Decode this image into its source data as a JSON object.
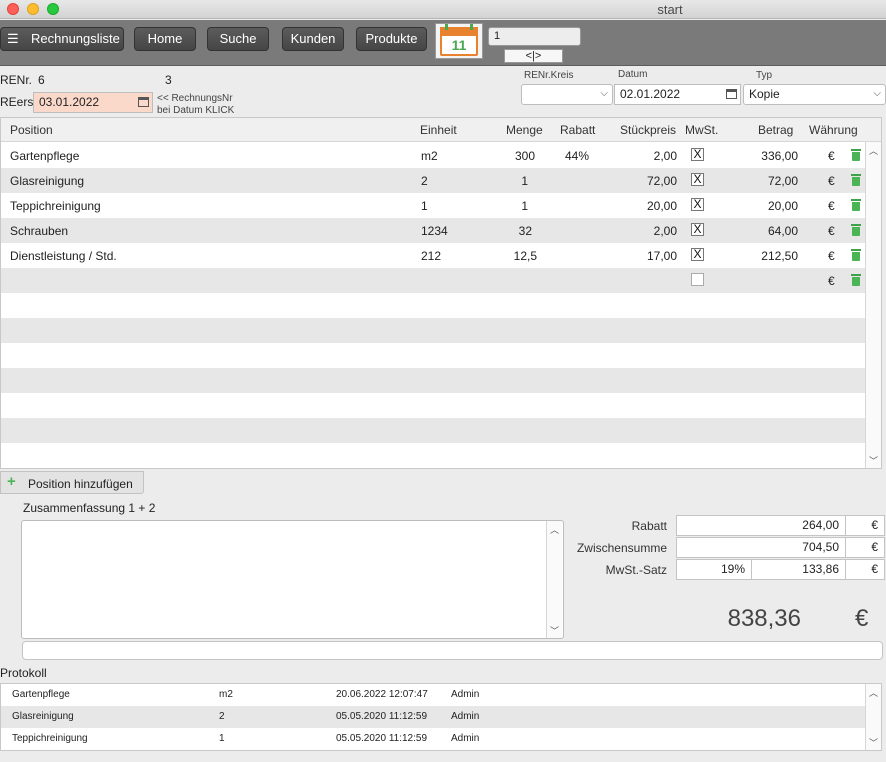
{
  "window": {
    "title": "start"
  },
  "toolbar": {
    "list_label": "Rechnungsliste",
    "home_label": "Home",
    "search_label": "Suche",
    "customers_label": "Kunden",
    "products_label": "Produkte",
    "calendar_day": "11",
    "record_number": "1",
    "nav_label": "<|>"
  },
  "header": {
    "renr_label": "RENr.",
    "renr_value": "6",
    "renr_second": "3",
    "reers_label": "REers",
    "reers_date": "03.01.2022",
    "hint_line1": "<< RechnungsNr",
    "hint_line2": "bei Datum KLICK",
    "kreis_label": "RENr.Kreis",
    "kreis_value": "",
    "datum_label": "Datum",
    "datum_value": "02.01.2022",
    "typ_label": "Typ",
    "typ_value": "Kopie"
  },
  "table": {
    "columns": [
      "Position",
      "Einheit",
      "Menge",
      "Rabatt",
      "Stückpreis",
      "MwSt.",
      "Betrag",
      "Währung"
    ],
    "rows": [
      {
        "position": "Gartenpflege",
        "einheit": "m2",
        "menge": "300",
        "rabatt": "44%",
        "stueckpreis": "2,00",
        "mwst": "X",
        "betrag": "336,00",
        "waehrung": "€"
      },
      {
        "position": "Glasreinigung",
        "einheit": "2",
        "menge": "1",
        "rabatt": "",
        "stueckpreis": "72,00",
        "mwst": "X",
        "betrag": "72,00",
        "waehrung": "€"
      },
      {
        "position": "Teppichreinigung",
        "einheit": "1",
        "menge": "1",
        "rabatt": "",
        "stueckpreis": "20,00",
        "mwst": "X",
        "betrag": "20,00",
        "waehrung": "€"
      },
      {
        "position": "Schrauben",
        "einheit": "1234",
        "menge": "32",
        "rabatt": "",
        "stueckpreis": "2,00",
        "mwst": "X",
        "betrag": "64,00",
        "waehrung": "€"
      },
      {
        "position": "Dienstleistung / Std.",
        "einheit": "212",
        "menge": "12,5",
        "rabatt": "",
        "stueckpreis": "17,00",
        "mwst": "X",
        "betrag": "212,50",
        "waehrung": "€"
      },
      {
        "position": "",
        "einheit": "",
        "menge": "",
        "rabatt": "",
        "stueckpreis": "",
        "mwst": "",
        "betrag": "",
        "waehrung": "€"
      }
    ]
  },
  "actions": {
    "add_position_label": "Position hinzufügen"
  },
  "summary": {
    "heading": "Zusammenfassung 1 + 2",
    "text": "",
    "rabatt_label": "Rabatt",
    "rabatt_value": "264,00",
    "rabatt_currency": "€",
    "zwischensumme_label": "Zwischensumme",
    "zwischensumme_value": "704,50",
    "zwischensumme_currency": "€",
    "mwst_label": "MwSt.-Satz",
    "mwst_rate": "19%",
    "mwst_value": "133,86",
    "mwst_currency": "€",
    "total_value": "838,36",
    "total_currency": "€",
    "note_text": ""
  },
  "protocol": {
    "heading": "Protokoll",
    "rows": [
      {
        "item": "Gartenpflege",
        "einheit": "m2",
        "timestamp": "20.06.2022 12:07:47",
        "user": "Admin"
      },
      {
        "item": "Glasreinigung",
        "einheit": "2",
        "timestamp": "05.05.2020 11:12:59",
        "user": "Admin"
      },
      {
        "item": "Teppichreinigung",
        "einheit": "1",
        "timestamp": "05.05.2020 11:12:59",
        "user": "Admin"
      }
    ]
  },
  "colors": {
    "date_field_bg": "#fbd9ca",
    "toolbar_bg": "#7a7a7a",
    "row_alt": "#e7e7e7",
    "trash_green": "#4bb556",
    "calendar_orange": "#e8822e"
  }
}
